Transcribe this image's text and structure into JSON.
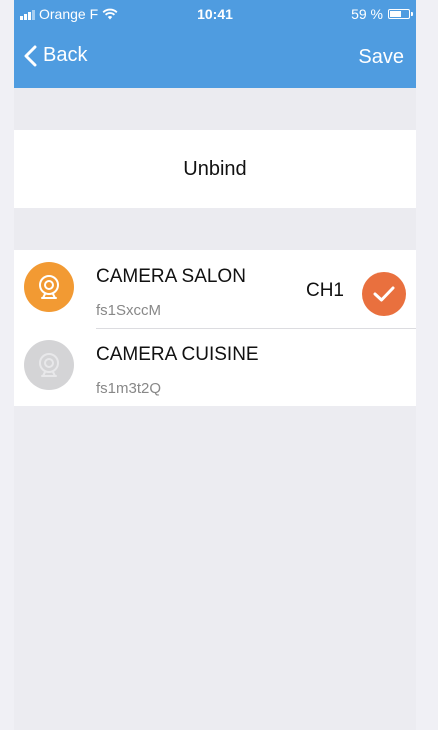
{
  "status_bar": {
    "carrier": "Orange F",
    "time": "10:41",
    "battery": "59 %"
  },
  "navbar": {
    "back_label": "Back",
    "save_label": "Save"
  },
  "actions": {
    "unbind_label": "Unbind"
  },
  "devices": [
    {
      "name": "CAMERA SALON",
      "id": "fs1SxccM",
      "channel": "CH1",
      "selected": true,
      "icon": "camera-icon"
    },
    {
      "name": "CAMERA CUISINE",
      "id": "fs1m3t2Q",
      "channel": "",
      "selected": false,
      "icon": "camera-icon"
    }
  ],
  "colors": {
    "header": "#4f9ce0",
    "accent_orange": "#f29a33",
    "check": "#e9703e"
  }
}
